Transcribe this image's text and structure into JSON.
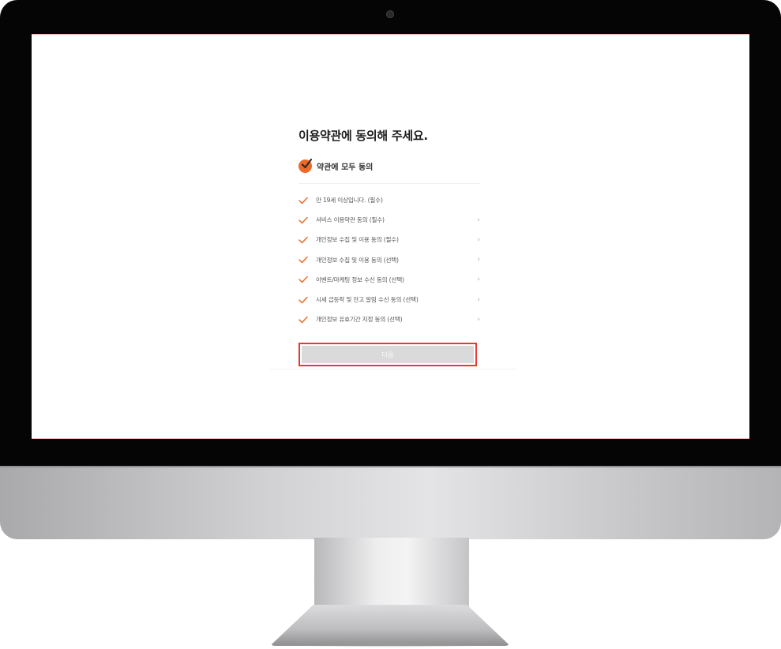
{
  "terms_page": {
    "title": "이용약관에 동의해 주세요.",
    "agree_all_label": "약관에 모두 동의",
    "items": [
      {
        "label": "만 19세 이상입니다. (필수)",
        "has_arrow": false
      },
      {
        "label": "서비스 이용약관 동의 (필수)",
        "has_arrow": true
      },
      {
        "label": "개인정보 수집 및 이용 동의 (필수)",
        "has_arrow": true
      },
      {
        "label": "개인정보 수집 및 이용 동의 (선택)",
        "has_arrow": true
      },
      {
        "label": "이벤트/마케팅 정보 수신 동의 (선택)",
        "has_arrow": true
      },
      {
        "label": "시세 급등락 및 잔고 알림 수신 동의 (선택)",
        "has_arrow": true
      },
      {
        "label": "개인정보 유효기간 지정 동의 (선택)",
        "has_arrow": true
      }
    ],
    "arrow_glyph": "›",
    "next_label": "다음"
  },
  "colors": {
    "accent": "#ee6a27",
    "highlight_border": "#e53935",
    "button_disabled": "#dadada"
  },
  "icons": {
    "agree_all": "check-circle-icon",
    "item_check": "check-icon",
    "item_arrow": "chevron-right-icon"
  }
}
